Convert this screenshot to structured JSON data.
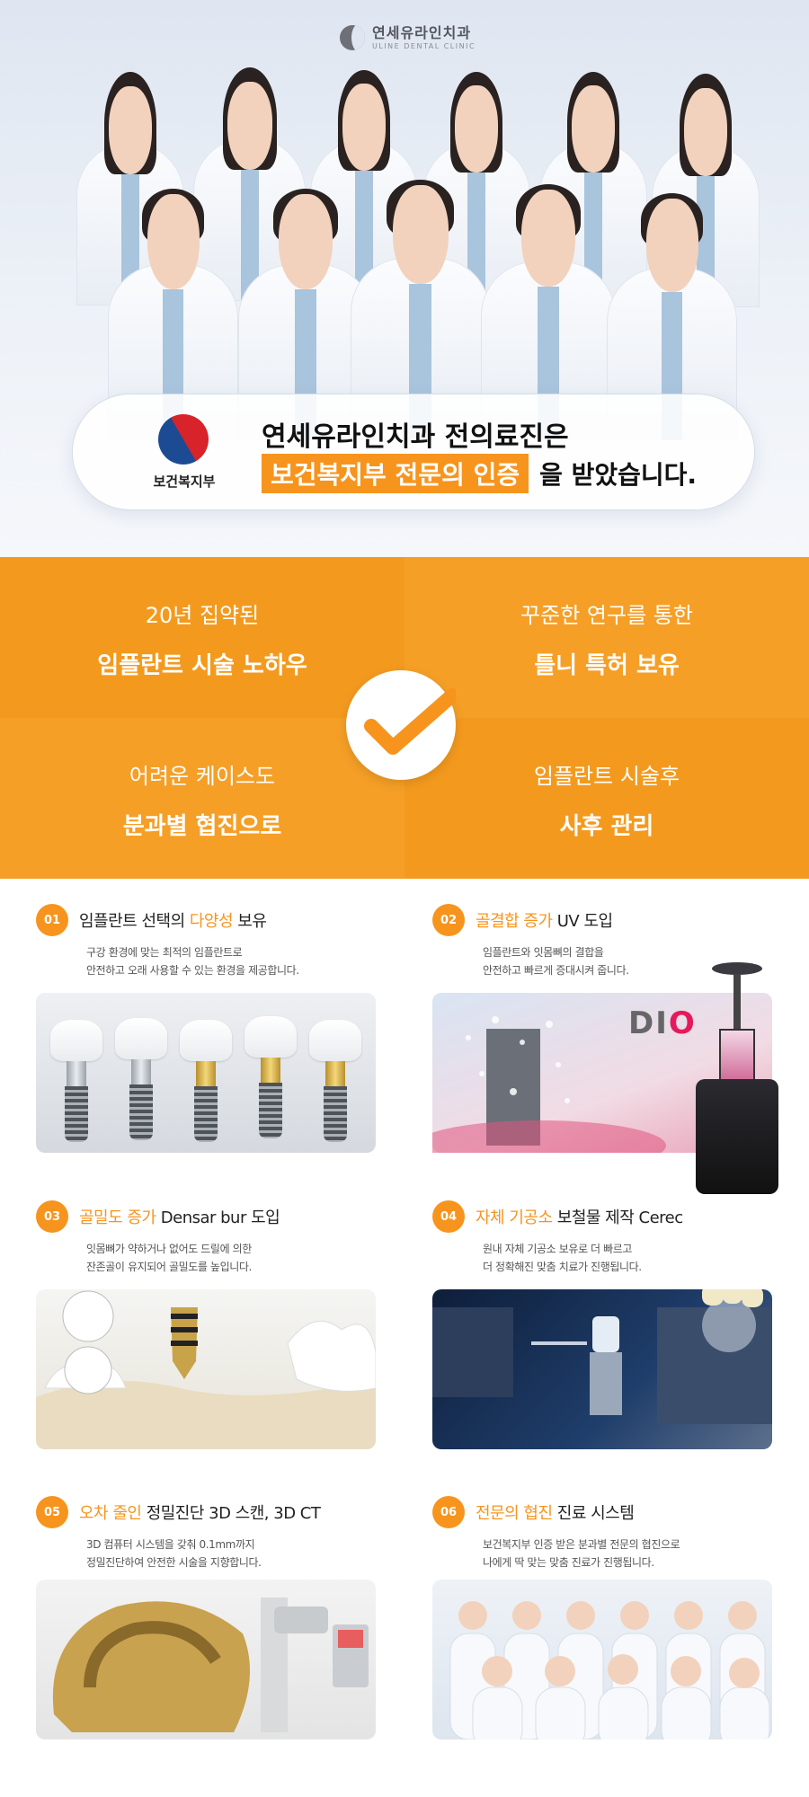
{
  "header": {
    "logo_ko": "연세유라인치과",
    "logo_en": "ULINE DENTAL CLINIC"
  },
  "certification": {
    "emblem_label": "보건복지부",
    "line1": "연세유라인치과 전의료진은",
    "highlight": "보건복지부 전문의 인증",
    "line2_rest": "을 받았습니다."
  },
  "highlights": [
    {
      "sub": "20년 집약된",
      "main": "임플란트 시술 노하우"
    },
    {
      "sub": "꾸준한 연구를 통한",
      "main": "틀니 특허 보유"
    },
    {
      "sub": "어려운 케이스도",
      "main": "분과별 협진으로"
    },
    {
      "sub": "임플란트 시술후",
      "main": "사후 관리"
    }
  ],
  "features": [
    {
      "num": "01",
      "title_pre": "임플란트 선택의 ",
      "title_hl": "다양성",
      "title_post": " 보유",
      "desc1": "구강 환경에 맞는 최적의 임플란트로",
      "desc2": "안전하고 오래 사용할 수 있는 환경을 제공합니다."
    },
    {
      "num": "02",
      "title_pre": "",
      "title_hl": "골결합 증가",
      "title_post": " UV 도입",
      "desc1": "임플란트와 잇몸뼈의 결합을",
      "desc2": "안전하고 빠르게 증대시켜 줍니다.",
      "brand": "DIO"
    },
    {
      "num": "03",
      "title_pre": "",
      "title_hl": "골밀도 증가",
      "title_post": " Densar bur 도입",
      "desc1": "잇몸뼈가 약하거나 없어도 드릴에 의한",
      "desc2": "잔존골이 유지되어 골밀도를 높입니다."
    },
    {
      "num": "04",
      "title_pre": "",
      "title_hl": "자체 기공소",
      "title_post": " 보철물 제작 Cerec",
      "desc1": "원내 자체 기공소 보유로 더 빠르고",
      "desc2": "더 정확해진 맞춤 치료가 진행됩니다."
    },
    {
      "num": "05",
      "title_pre": "",
      "title_hl": "오차 줄인",
      "title_post": " 정밀진단 3D 스캔, 3D CT",
      "desc1": "3D 컴퓨터 시스템을 갖춰 0.1mm까지",
      "desc2": "정밀진단하여 안전한 시술을 지향합니다."
    },
    {
      "num": "06",
      "title_pre": "",
      "title_hl": "전문의 협진",
      "title_post": " 진료 시스템",
      "desc1": "보건복지부 인증 받은 분과별 전문의 협진으로",
      "desc2": "나에게 딱 맞는 맞춤 진료가 진행됩니다."
    }
  ],
  "colors": {
    "accent": "#f7941d",
    "orange_a": "#f39a1e",
    "orange_b": "#f59f27"
  }
}
